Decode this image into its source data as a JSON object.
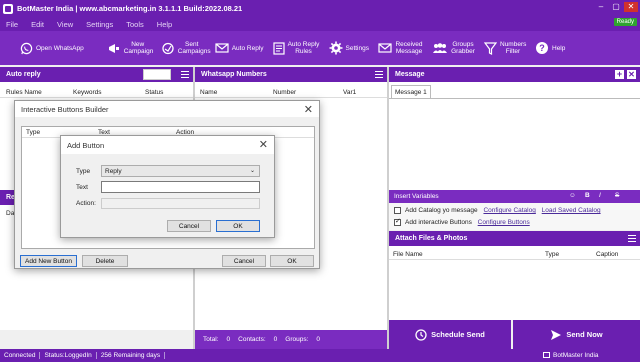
{
  "window": {
    "title": "BotMaster India | www.abcmarketing.in 3.1.1.1 Build:2022.08.21",
    "status_badge": "Ready"
  },
  "menu": [
    "File",
    "Edit",
    "View",
    "Settings",
    "Tools",
    "Help"
  ],
  "toolbar": [
    {
      "label": "Open WhatsApp",
      "icon": "whatsapp-icon"
    },
    {
      "label": "New Campaign",
      "icon": "megaphone-icon"
    },
    {
      "label": "Sent Campaigns",
      "icon": "sent-campaigns-icon"
    },
    {
      "label": "Auto Reply",
      "icon": "envelope-icon"
    },
    {
      "label": "Auto Reply Rules",
      "icon": "rules-icon"
    },
    {
      "label": "Settings",
      "icon": "gear-icon"
    },
    {
      "label": "Received Message",
      "icon": "received-message-icon"
    },
    {
      "label": "Groups Grabber",
      "icon": "groups-icon"
    },
    {
      "label": "Numbers Filter",
      "icon": "funnel-icon"
    },
    {
      "label": "Help",
      "icon": "help-icon"
    }
  ],
  "auto_reply": {
    "title": "Auto reply",
    "columns": [
      "Rules Name",
      "Keywords",
      "Status"
    ],
    "lower_title_partial": "Re",
    "lower_col_partial": "Da"
  },
  "whatsapp_numbers": {
    "title": "Whatsapp Numbers",
    "columns": [
      "Name",
      "Number",
      "Var1"
    ],
    "footer": {
      "total_label": "Total:",
      "total": "0",
      "contacts_label": "Contacts:",
      "contacts": "0",
      "groups_label": "Groups:",
      "groups": "0"
    }
  },
  "message": {
    "title": "Message",
    "tab": "Message 1",
    "insert_variables": "Insert Variables",
    "catalog_checkbox": "Add Catalog yo message",
    "configure_catalog": "Configure Catalog",
    "load_catalog": "Load Saved Catalog",
    "interactive_checkbox": "Add interactive Buttons",
    "configure_buttons": "Configure Buttons"
  },
  "attach": {
    "title": "Attach Files & Photos",
    "columns": [
      "File Name",
      "Type",
      "Caption"
    ]
  },
  "actions": {
    "schedule": "Schedule Send",
    "send": "Send Now"
  },
  "status_bar": {
    "connected": "Connected",
    "status": "Status:LoggedIn",
    "remaining": "256 Remaining days",
    "brand": "BotMaster India"
  },
  "interactive_dialog": {
    "title": "Interactive Buttons Builder",
    "columns": [
      "Type",
      "Text",
      "Action"
    ],
    "add_new": "Add New Button",
    "delete": "Delete",
    "cancel": "Cancel",
    "ok": "OK"
  },
  "add_button_dialog": {
    "title": "Add Button",
    "type_label": "Type",
    "type_value": "Reply",
    "text_label": "Text",
    "text_value": "",
    "action_label": "Action:",
    "action_value": "",
    "cancel": "Cancel",
    "ok": "OK"
  }
}
